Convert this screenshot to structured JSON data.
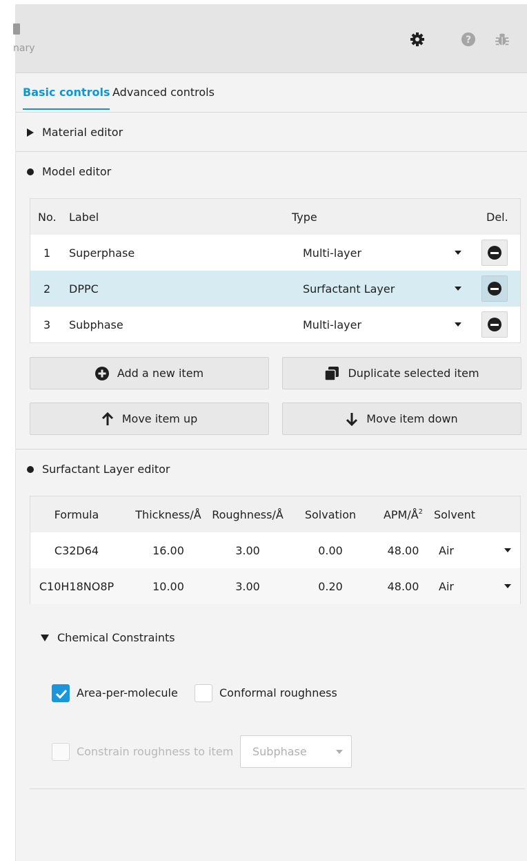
{
  "header": {
    "summary_label": "nary",
    "icons": [
      "gear-icon",
      "help-icon",
      "bug-icon"
    ]
  },
  "tabs": [
    {
      "label": "Basic controls",
      "active": true
    },
    {
      "label": "Advanced controls",
      "active": false
    }
  ],
  "material_editor": {
    "label": "Material editor"
  },
  "model_editor": {
    "label": "Model editor",
    "columns": {
      "no": "No.",
      "label": "Label",
      "type": "Type",
      "del": "Del."
    },
    "rows": [
      {
        "no": "1",
        "label": "Superphase",
        "type": "Multi-layer",
        "selected": false
      },
      {
        "no": "2",
        "label": "DPPC",
        "type": "Surfactant Layer",
        "selected": true
      },
      {
        "no": "3",
        "label": "Subphase",
        "type": "Multi-layer",
        "selected": false
      }
    ],
    "buttons": {
      "add": "Add a new item",
      "duplicate": "Duplicate selected item",
      "move_up": "Move item up",
      "move_down": "Move item down"
    }
  },
  "surfactant_editor": {
    "label": "Surfactant Layer editor",
    "columns": {
      "formula": "Formula",
      "thickness": "Thickness/Å",
      "roughness": "Roughness/Å",
      "solvation": "Solvation",
      "apm": "APM/Å",
      "apm_sup": "2",
      "solvent": "Solvent"
    },
    "rows": [
      {
        "formula": "C32D64",
        "thickness": "16.00",
        "roughness": "3.00",
        "solvation": "0.00",
        "apm": "48.00",
        "solvent": "Air"
      },
      {
        "formula": "C10H18NO8P",
        "thickness": "10.00",
        "roughness": "3.00",
        "solvation": "0.20",
        "apm": "48.00",
        "solvent": "Air"
      }
    ]
  },
  "constraints": {
    "label": "Chemical Constraints",
    "area_per_molecule": {
      "label": "Area-per-molecule",
      "checked": true
    },
    "conformal_roughness": {
      "label": "Conformal roughness",
      "checked": false
    },
    "constrain_roughness": {
      "label": "Constrain roughness to item",
      "checked": false,
      "disabled": true
    },
    "constrain_item_select": {
      "value": "Subphase"
    }
  },
  "colors": {
    "accent": "#0d97d4",
    "selected_row": "#d6ecf2",
    "checkbox": "#1996dc"
  }
}
